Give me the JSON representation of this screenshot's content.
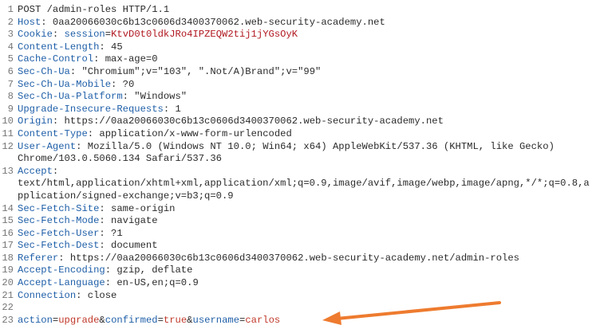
{
  "request": {
    "lines": [
      {
        "n": "1",
        "text": "POST /admin-roles HTTP/1.1"
      },
      {
        "n": "2",
        "key": "Host",
        "value": " 0aa20066030c6b13c0606d3400370062.web-security-academy.net"
      },
      {
        "n": "3",
        "key": "Cookie",
        "cookie_name": " session",
        "cookie_value": "KtvD0t0ldkJRo4IPZEQW2tij1jYGsOyK"
      },
      {
        "n": "4",
        "key": "Content-Length",
        "value": " 45"
      },
      {
        "n": "5",
        "key": "Cache-Control",
        "value": " max-age=0"
      },
      {
        "n": "6",
        "key": "Sec-Ch-Ua",
        "value": " \"Chromium\";v=\"103\", \".Not/A)Brand\";v=\"99\""
      },
      {
        "n": "7",
        "key": "Sec-Ch-Ua-Mobile",
        "value": " ?0"
      },
      {
        "n": "8",
        "key": "Sec-Ch-Ua-Platform",
        "value": " \"Windows\""
      },
      {
        "n": "9",
        "key": "Upgrade-Insecure-Requests",
        "value": " 1"
      },
      {
        "n": "10",
        "key": "Origin",
        "value": " https://0aa20066030c6b13c0606d3400370062.web-security-academy.net"
      },
      {
        "n": "11",
        "key": "Content-Type",
        "value": " application/x-www-form-urlencoded"
      },
      {
        "n": "12",
        "key": "User-Agent",
        "value": " Mozilla/5.0 (Windows NT 10.0; Win64; x64) AppleWebKit/537.36 (KHTML, like Gecko) Chrome/103.0.5060.134 Safari/537.36"
      },
      {
        "n": "13",
        "key": "Accept",
        "value": "\ntext/html,application/xhtml+xml,application/xml;q=0.9,image/avif,image/webp,image/apng,*/*;q=0.8,application/signed-exchange;v=b3;q=0.9"
      },
      {
        "n": "14",
        "key": "Sec-Fetch-Site",
        "value": " same-origin"
      },
      {
        "n": "15",
        "key": "Sec-Fetch-Mode",
        "value": " navigate"
      },
      {
        "n": "16",
        "key": "Sec-Fetch-User",
        "value": " ?1"
      },
      {
        "n": "17",
        "key": "Sec-Fetch-Dest",
        "value": " document"
      },
      {
        "n": "18",
        "key": "Referer",
        "value": " https://0aa20066030c6b13c0606d3400370062.web-security-academy.net/admin-roles"
      },
      {
        "n": "19",
        "key": "Accept-Encoding",
        "value": " gzip, deflate"
      },
      {
        "n": "20",
        "key": "Accept-Language",
        "value": " en-US,en;q=0.9"
      },
      {
        "n": "21",
        "key": "Connection",
        "value": " close"
      },
      {
        "n": "22",
        "text": ""
      }
    ],
    "body_line": {
      "n": "23",
      "params": [
        {
          "name": "action",
          "value": "upgrade"
        },
        {
          "name": "confirmed",
          "value": "true"
        },
        {
          "name": "username",
          "value": "carlos"
        }
      ]
    }
  },
  "colors": {
    "header_key": "#1f5fa8",
    "cookie_value": "#b0171f",
    "param_value": "#c0392b",
    "arrow": "#ee7b2f"
  }
}
